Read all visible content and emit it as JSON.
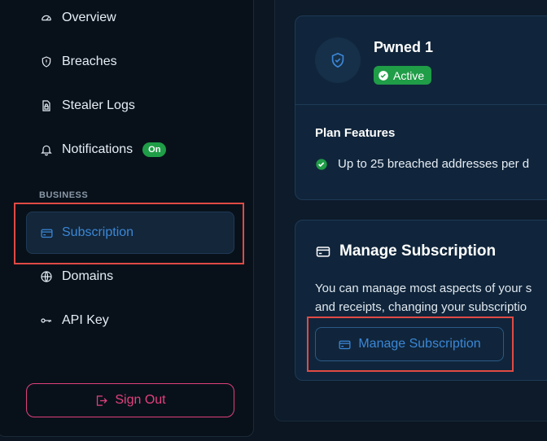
{
  "sidebar": {
    "items": [
      {
        "label": "Overview",
        "icon": "gauge-icon"
      },
      {
        "label": "Breaches",
        "icon": "alert-shield-icon"
      },
      {
        "label": "Stealer Logs",
        "icon": "file-lock-icon"
      },
      {
        "label": "Notifications",
        "icon": "bell-icon",
        "badge": "On"
      }
    ],
    "section_label": "BUSINESS",
    "business_items": [
      {
        "label": "Subscription",
        "icon": "credit-card-icon",
        "active": true
      },
      {
        "label": "Domains",
        "icon": "globe-icon"
      },
      {
        "label": "API Key",
        "icon": "key-icon"
      }
    ],
    "sign_out_label": "Sign Out"
  },
  "plan_card": {
    "plan_name": "Pwned 1",
    "status": "Active",
    "features_title": "Plan Features",
    "feature_text": "Up to 25 breached addresses per d"
  },
  "manage_card": {
    "title": "Manage Subscription",
    "description_line1": "You can manage most aspects of your s",
    "description_line2": "and receipts, changing your subscriptio",
    "button_label": "Manage Subscription"
  },
  "colors": {
    "accent_blue": "#3b87d6",
    "success_green": "#1f9d47",
    "danger_pink": "#e5407e",
    "highlight_red": "#e04a45"
  }
}
